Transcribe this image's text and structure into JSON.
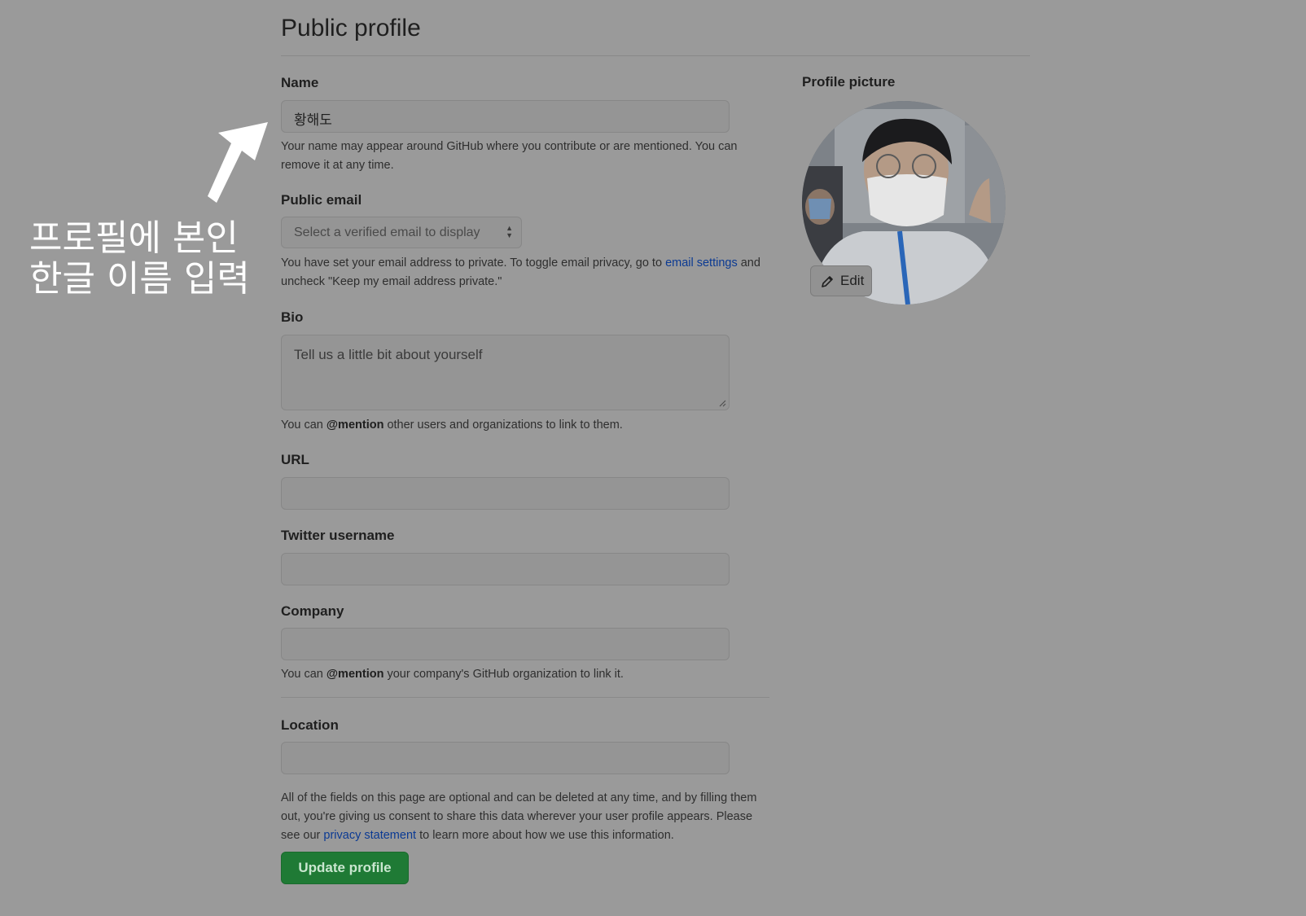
{
  "page_title": "Public profile",
  "name": {
    "label": "Name",
    "value": "황해도",
    "help": "Your name may appear around GitHub where you contribute or are mentioned. You can remove it at any time."
  },
  "public_email": {
    "label": "Public email",
    "selected": "Select a verified email to display",
    "help_prefix": "You have set your email address to private. To toggle email privacy, go to ",
    "help_link": "email settings",
    "help_suffix": " and uncheck \"Keep my email address private.\""
  },
  "bio": {
    "label": "Bio",
    "placeholder": "Tell us a little bit about yourself",
    "help_prefix": "You can ",
    "help_mention": "@mention",
    "help_suffix": " other users and organizations to link to them."
  },
  "url": {
    "label": "URL",
    "value": ""
  },
  "twitter": {
    "label": "Twitter username",
    "value": ""
  },
  "company": {
    "label": "Company",
    "value": "",
    "help_prefix": "You can ",
    "help_mention": "@mention",
    "help_suffix": " your company's GitHub organization to link it."
  },
  "location": {
    "label": "Location",
    "value": ""
  },
  "footer": {
    "text_prefix": "All of the fields on this page are optional and can be deleted at any time, and by filling them out, you're giving us consent to share this data wherever your user profile appears. Please see our ",
    "link": "privacy statement",
    "text_suffix": " to learn more about how we use this information."
  },
  "update_button": "Update profile",
  "profile_picture": {
    "label": "Profile picture",
    "edit_label": "Edit"
  },
  "annotation": {
    "line1": "프로필에 본인",
    "line2": "한글 이름 입력"
  },
  "colors": {
    "overlay": "#9a9a9a",
    "link": "#0b3a93",
    "button": "#1f7a35"
  }
}
